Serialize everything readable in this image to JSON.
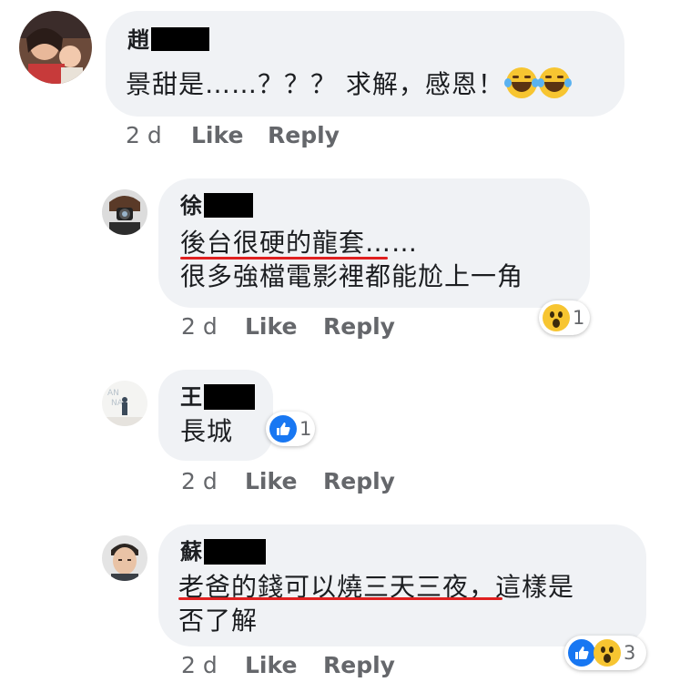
{
  "comments": [
    {
      "author": "趙",
      "lines": [
        "景甜是……？？？ 求解，感恩！"
      ],
      "emoji": [
        "laughing-tears-icon",
        "laughing-tears-icon"
      ],
      "time": "2 d",
      "like_label": "Like",
      "reply_label": "Reply"
    },
    {
      "author": "徐",
      "lines": [
        "後台很硬的龍套……",
        "很多強檔電影裡都能尬上一角"
      ],
      "reactions": {
        "icons": [
          "wow-icon"
        ],
        "count": "1"
      },
      "time": "2 d",
      "like_label": "Like",
      "reply_label": "Reply"
    },
    {
      "author": "王",
      "lines": [
        "長城"
      ],
      "reactions": {
        "icons": [
          "like-icon"
        ],
        "count": "1"
      },
      "time": "2 d",
      "like_label": "Like",
      "reply_label": "Reply"
    },
    {
      "author": "蘇",
      "lines": [
        "老爸的錢可以燒三天三夜，這樣是",
        "否了解"
      ],
      "reactions": {
        "icons": [
          "like-icon",
          "wow-icon"
        ],
        "count": "3"
      },
      "time": "2 d",
      "like_label": "Like",
      "reply_label": "Reply"
    }
  ],
  "colors": {
    "bubble": "#f0f2f5",
    "meta": "#65676b",
    "underline": "#e02020",
    "like": "#1877f2",
    "wow": "#f7c531"
  }
}
